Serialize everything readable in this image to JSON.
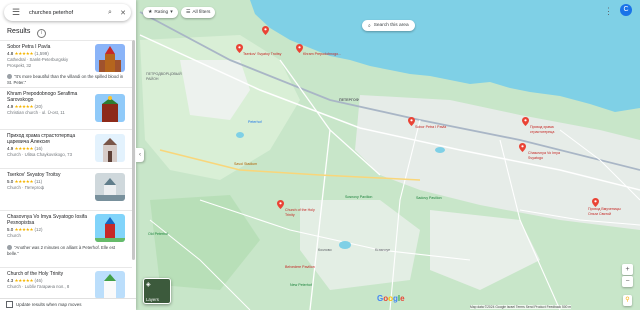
{
  "search": {
    "query": "churches peterhof"
  },
  "results": {
    "title": "Results"
  },
  "items": [
    {
      "name": "Sobor Petra I Pavla",
      "rating": "4.8",
      "stars": "★★★★★",
      "count": "(1,599)",
      "meta1": "Cathedral · Sankt-Peterburgskiy",
      "meta2": "Prospekt, 32",
      "review": "\"It's more beautiful than the villandi on the spilled blood in St. Peter.\""
    },
    {
      "name": "Khram Prepodobnogo Serafima Sarovskogo",
      "rating": "4.9",
      "stars": "★★★★★",
      "count": "(20)",
      "meta1": "Christian church · ul. Ü-ost, 11",
      "meta2": "",
      "review": ""
    },
    {
      "name": "Приход храма страстотерпца царевича Алексия",
      "rating": "4.9",
      "stars": "★★★★★",
      "count": "(16)",
      "meta1": "Church · Ulitsa Chaykovskogo, 73",
      "meta2": "",
      "review": ""
    },
    {
      "name": "Tserkov' Svyatoy Troitsy",
      "rating": "5.0",
      "stars": "★★★★★",
      "count": "(11)",
      "meta1": "Church · Петергоф",
      "meta2": "",
      "review": ""
    },
    {
      "name": "Chasovnya Vo Imya Svyatogo Iosifa Pesnopistsa",
      "rating": "5.0",
      "stars": "★★★★★",
      "count": "(12)",
      "meta1": "Church",
      "meta2": "",
      "review": "\"Another was 2 minutes on alliant à Peterhof. Elle est belle.\""
    },
    {
      "name": "Church of the Holy Trinity",
      "rating": "4.3",
      "stars": "★★★★★",
      "count": "(46)",
      "meta1": "Church · Lubliv Гагарина пол., 8",
      "meta2": "",
      "review": ""
    }
  ],
  "footer": {
    "label": "Update results when map moves"
  },
  "filters": {
    "rating": "Rating",
    "all_filters": "All filters"
  },
  "map": {
    "search_area": "Search this area",
    "layers": "Layers",
    "attribution": "Map data ©2024 Google  Israel  Terms  Send Product Feedback  500 m",
    "logo": "Google",
    "labels": {
      "tserkov": "Tserkov' Svyatoy Troitsy",
      "khram": "Khram Prepodobnogo...",
      "sobor": "Sobor Petra I Pavla",
      "prikhod1": "Приход храма страстотерпца",
      "chasovnya": "Chasovnya Vo Imya Svyatogo",
      "holy_trinity": "Church of the Holy Trinity",
      "prikhod2": "Приход Вмученицы Ольги Святой",
      "savol": "Savol Stadium",
      "sosnovy": "Sosnovy Pavilion",
      "peterhof": "ПЕТЕРГОФ",
      "district": "ПЕТРОДВОРЦОВЫЙ РАЙОН",
      "peterhof_en": "Peterhof",
      "kozlovo": "Козлово",
      "krasnoye": "Krasnoye",
      "old_peterhof": "Old Peterhof",
      "new_peterhof": "New Peterhof",
      "belvedere": "Belvedere Pavilion",
      "sadovy": "Sadovy Pavilion"
    }
  }
}
